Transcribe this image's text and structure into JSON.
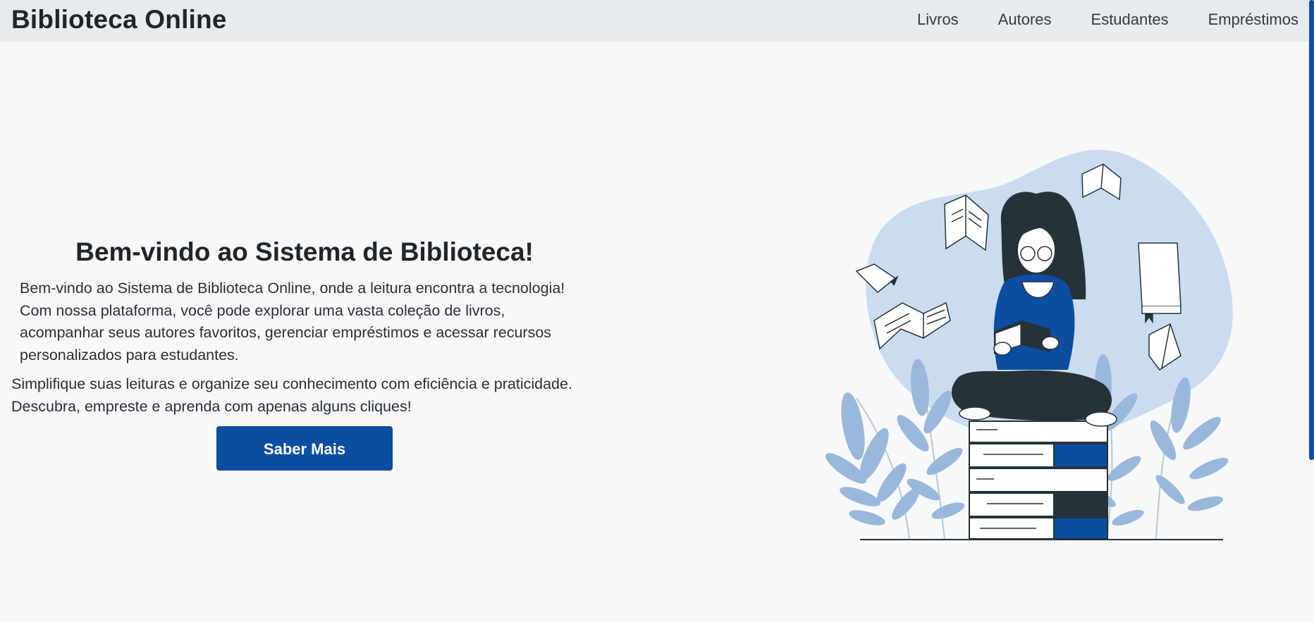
{
  "navbar": {
    "brand": "Biblioteca Online",
    "links": [
      {
        "label": "Livros"
      },
      {
        "label": "Autores"
      },
      {
        "label": "Estudantes"
      },
      {
        "label": "Empréstimos"
      }
    ]
  },
  "hero": {
    "title": "Bem-vindo ao Sistema de Biblioteca!",
    "paragraph1_lines": [
      "Bem-vindo ao Sistema de Biblioteca Online, onde a leitura encontra a tecnologia!",
      "Com nossa plataforma, você pode explorar uma vasta coleção de livros,",
      "acompanhar seus autores favoritos, gerenciar empréstimos e acessar recursos",
      "personalizados para estudantes."
    ],
    "paragraph2_lines": [
      "Simplifique suas leituras e organize seu conhecimento com eficiência e praticidade.",
      "Descubra, empreste e aprenda com apenas alguns cliques!"
    ],
    "button_label": "Saber Mais"
  },
  "illustration": {
    "icon": "woman-reading-on-books-illustration"
  },
  "colors": {
    "primary": "#0b4ea2",
    "navbar_bg": "#e8ebee",
    "page_bg": "#f7f8fa",
    "blob": "#cbdcef",
    "dark": "#263238",
    "leaf": "#9ab8db"
  }
}
